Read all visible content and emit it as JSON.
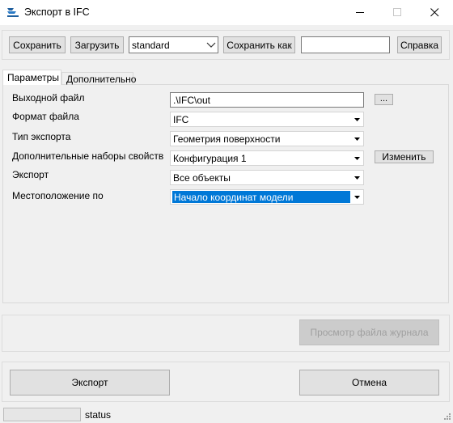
{
  "window": {
    "title": "Экспорт в IFC"
  },
  "toolbar": {
    "save_label": "Сохранить",
    "load_label": "Загрузить",
    "config_value": "standard",
    "save_as_label": "Сохранить как",
    "name_value": "",
    "help_label": "Справка"
  },
  "tabs": [
    {
      "label": "Параметры"
    },
    {
      "label": "Дополнительно"
    }
  ],
  "params": {
    "output_file_label": "Выходной файл",
    "output_file_value": ".\\IFC\\out",
    "browse_label": "...",
    "file_format_label": "Формат файла",
    "file_format_value": "IFC",
    "export_type_label": "Тип экспорта",
    "export_type_value": "Геометрия поверхности",
    "property_sets_label": "Дополнительные наборы свойств",
    "property_sets_value": "Конфигурация 1",
    "edit_label": "Изменить",
    "export_label": "Экспорт",
    "export_value": "Все объекты",
    "location_label": "Местоположение по",
    "location_value": "Начало координат модели"
  },
  "log": {
    "view_log_label": "Просмотр файла журнала"
  },
  "actions": {
    "export_label": "Экспорт",
    "cancel_label": "Отмена"
  },
  "statusbar": {
    "status_text": "status",
    "progress": 0
  },
  "colors": {
    "selection": "#0078d7",
    "background": "#f0f0f0"
  }
}
